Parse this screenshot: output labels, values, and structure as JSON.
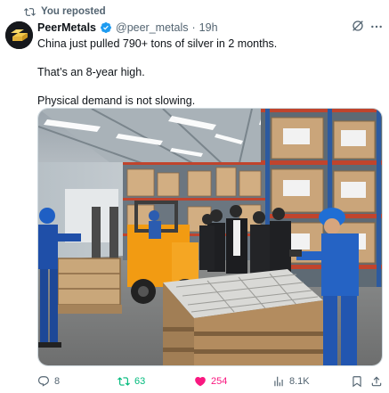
{
  "repost_label": "You reposted",
  "author": {
    "name": "PeerMetals",
    "handle": "@peer_metals",
    "separator": "·",
    "time": "19h"
  },
  "tweet": {
    "lines": [
      "China just pulled 790+ tons of silver in 2 months.",
      "That’s an 8-year high.",
      "Physical demand is not slowing."
    ]
  },
  "media": {
    "description_icon": "warehouse-photo"
  },
  "actions": {
    "reply_count": "8",
    "repost_count": "63",
    "like_count": "254",
    "views_count": "8.1K"
  },
  "colors": {
    "repost_active": "#00ba7c",
    "like_active": "#f91880",
    "verified": "#1d9bf0",
    "secondary_text": "#536471"
  }
}
